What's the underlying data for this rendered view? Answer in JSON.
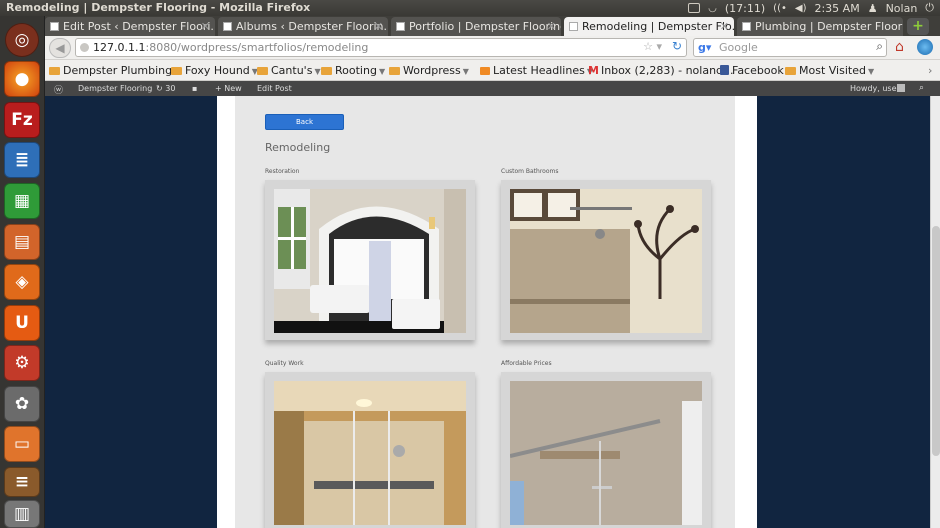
{
  "system": {
    "window_title": "Remodeling | Dempster Flooring - Mozilla Firefox",
    "battery": "(17:11)",
    "time": "2:35 AM",
    "user": "Nolan"
  },
  "tabs": [
    {
      "label": "Edit Post ‹ Dempster Floori..."
    },
    {
      "label": "Albums ‹ Dempster Floorin..."
    },
    {
      "label": "Portfolio | Dempster Flooring"
    },
    {
      "label": "Remodeling | Dempster Flo..."
    },
    {
      "label": "Plumbing | Dempster Flooring"
    }
  ],
  "navbar": {
    "url_host": "127.0.1.1",
    "url_path": ":8080/wordpress/smartfolios/remodeling",
    "search_placeholder": "Google"
  },
  "bookmarks": [
    {
      "label": "Dempster Plumbing"
    },
    {
      "label": "Foxy Hound"
    },
    {
      "label": "Cantu's"
    },
    {
      "label": "Rooting"
    },
    {
      "label": "Wordpress"
    },
    {
      "label": "Latest Headlines"
    },
    {
      "label": "Inbox (2,283) - noland..."
    },
    {
      "label": "Facebook"
    },
    {
      "label": "Most Visited"
    }
  ],
  "wp_admin": {
    "site": "Dempster Flooring",
    "updates": "30",
    "new": "New",
    "edit_post": "Edit Post",
    "howdy": "Howdy, user"
  },
  "page": {
    "back_label": "Back",
    "heading": "Remodeling",
    "items": [
      {
        "caption": "Restoration"
      },
      {
        "caption": "Custom Bathrooms"
      },
      {
        "caption": "Quality Work"
      },
      {
        "caption": "Affordable Prices"
      }
    ]
  },
  "colors": {
    "page_background": "#112540",
    "button_blue": "#2d74d3"
  }
}
